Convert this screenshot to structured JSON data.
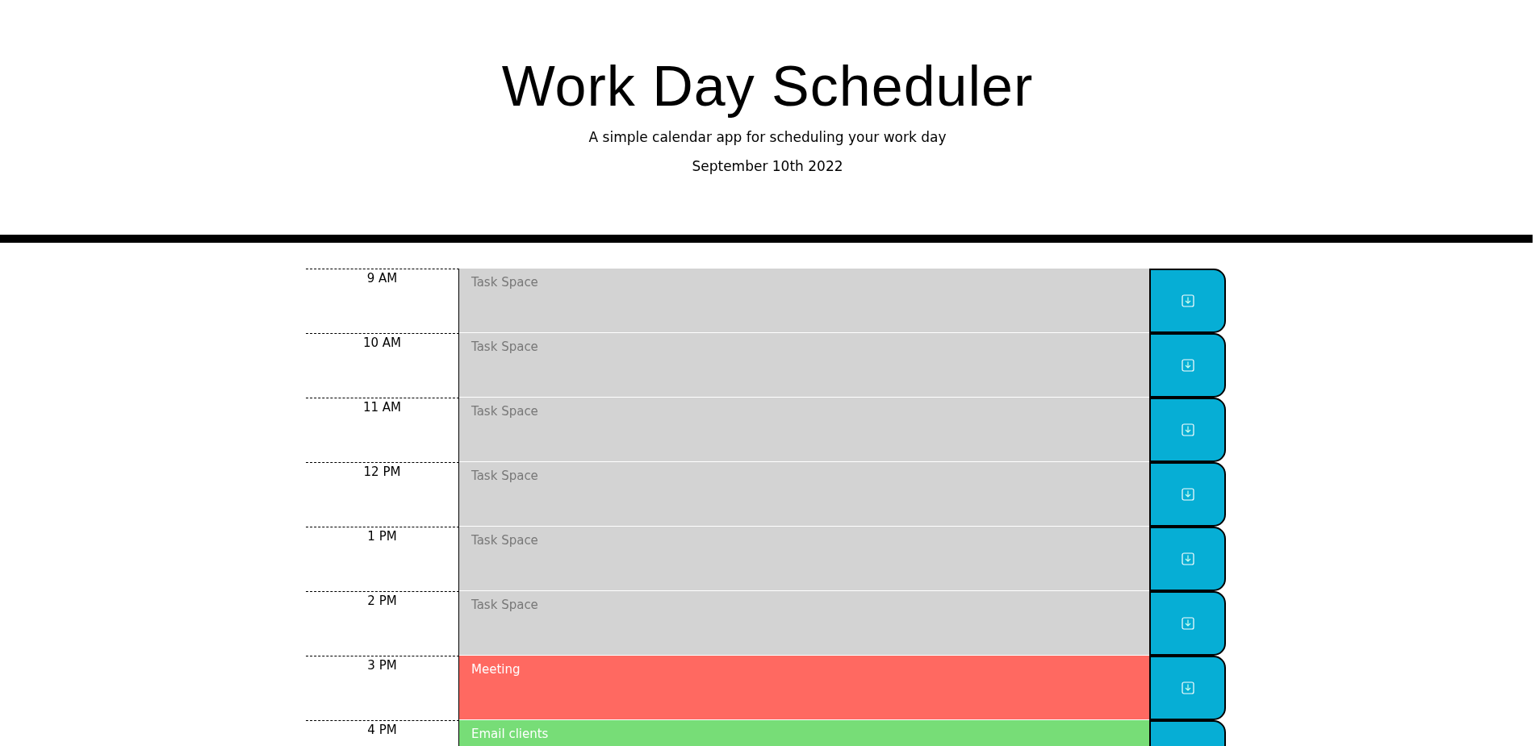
{
  "header": {
    "title": "Work Day Scheduler",
    "subtitle": "A simple calendar app for scheduling your work day",
    "date": "September 10th 2022"
  },
  "hours": [
    {
      "time": "9 AM",
      "color": "#d3d3d3",
      "placeholder": "Task Space"
    },
    {
      "time": "10 AM",
      "color": "#d3d3d3",
      "placeholder": "Task Space"
    },
    {
      "time": "11 AM",
      "color": "#d3d3d3",
      "placeholder": "Task Space"
    },
    {
      "time": "12 PM",
      "color": "#d3d3d3",
      "placeholder": "Task Space"
    },
    {
      "time": "1 PM",
      "color": "#d3d3d3",
      "placeholder": "Task Space"
    },
    {
      "time": "2 PM",
      "color": "#d3d3d3",
      "placeholder": "Task Space"
    },
    {
      "time": "3 PM",
      "color": "#ff6961",
      "value": "Meeting"
    },
    {
      "time": "4 PM",
      "color": "#77dd77",
      "value": "Email clients"
    }
  ]
}
